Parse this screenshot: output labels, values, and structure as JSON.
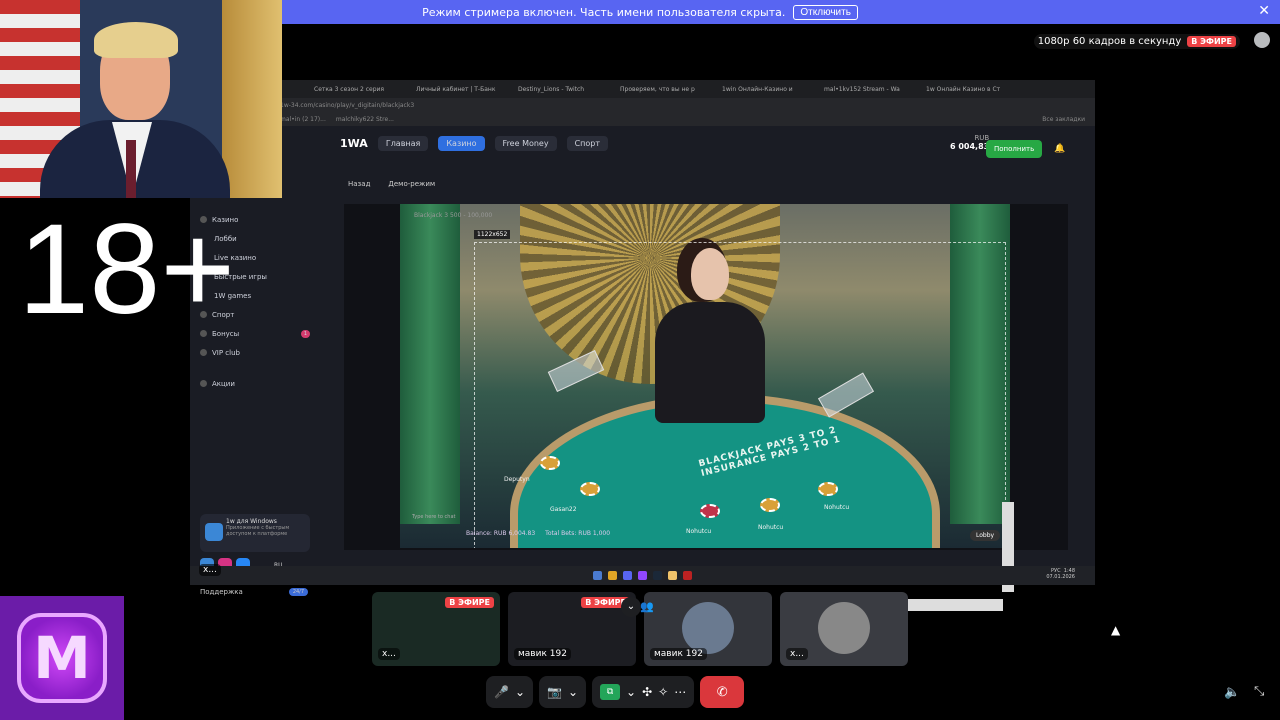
{
  "banner": {
    "text": "Режим стримера включен. Часть имени пользователя скрыта.",
    "button": "Отключить",
    "close": "✕"
  },
  "stream_info": {
    "quality": "1080p 60 кадров в секунду",
    "live": "В ЭФИРЕ"
  },
  "overlay": {
    "age_rating": "18+"
  },
  "browser": {
    "tabs": [
      "Сетка 3 сезон 2 серия",
      "Личный кабинет | Т-Банк",
      "Destiny_Lions - Twitch",
      "Проверяем, что вы не р",
      "1win Онлайн-Казино и",
      "mal•1kv152 Stream - Wa",
      "1w Онлайн Казино в Ст"
    ],
    "address": "1w-34.com/casino/play/v_digitain/blackjack3",
    "bookmarks": [
      "mal•in (2 17)...",
      "malchiky622 Stre...",
      "Все закладки"
    ]
  },
  "site": {
    "logo": "1WA",
    "nav": [
      "Главная",
      "Казино",
      "Free Money",
      "Спорт"
    ],
    "balance_currency": "RUB",
    "balance_value": "6 004,83",
    "topup": "Пополнить",
    "back": "Назад",
    "demo": "Демо-режим",
    "sidebar": [
      "Казино",
      "Лобби",
      "Live казино",
      "Быстрые игры",
      "1W games",
      "Спорт",
      "Бонусы",
      "VIP club",
      "Акции"
    ],
    "bonus_badge": "1",
    "promo_title": "1w для Windows",
    "promo_text": "Приложение с быстрым доступом к платформе",
    "lang": "RU",
    "support": "Поддержка",
    "support_badge": "24/7"
  },
  "game": {
    "title": "Blackjack 3  500 - 100,000",
    "size_label": "1122x652",
    "table_line1": "BLACKJACK PAYS 3 TO 2",
    "table_line2": "INSURANCE PAYS 2 TO 1",
    "players": [
      "Deputyn",
      "Gasan22",
      "Nohutcu",
      "Nohutcu",
      "Nohutcu"
    ],
    "chat_placeholder": "Type here to chat",
    "balance": "Balance: RUB 6,004.83",
    "total_bets": "Total Bets: RUB 1,000",
    "lobby": "Lobby"
  },
  "taskbar": {
    "lang": "РУС",
    "time": "1:48",
    "date": "07.01.2026"
  },
  "screen_label": "x...",
  "tiles": [
    {
      "name": "x...",
      "live": "В ЭФИРЕ"
    },
    {
      "name": "мавик 192",
      "live": "В ЭФИРЕ"
    },
    {
      "name": "мавик 192"
    },
    {
      "name": "x..."
    }
  ],
  "controls": {
    "mic": "🎤",
    "camera": "📷",
    "share": "⧉",
    "activities": "✣",
    "effects": "✧",
    "more": "⋯",
    "leave": "✆"
  }
}
